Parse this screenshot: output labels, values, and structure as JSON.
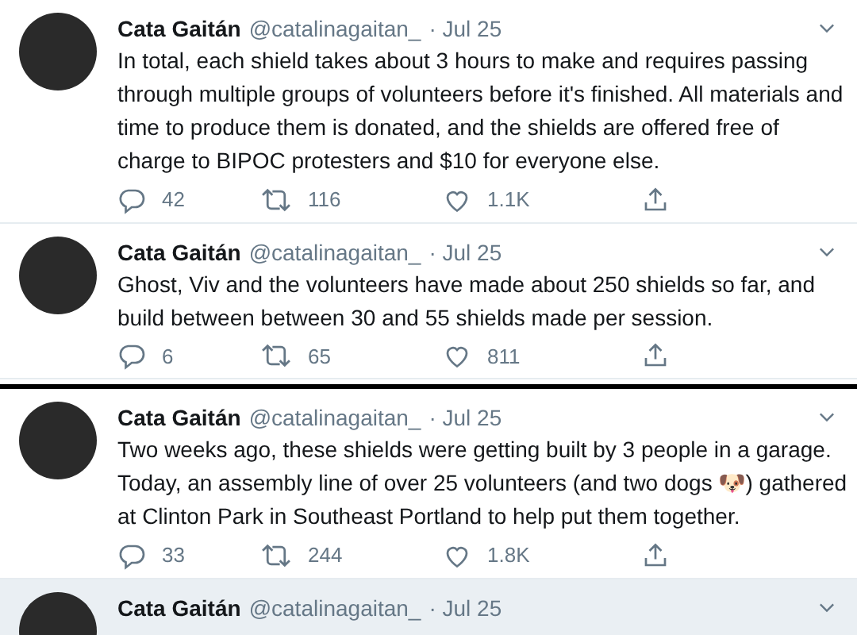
{
  "tweets": [
    {
      "name": "Cata Gaitán",
      "handle": "@catalinagaitan_",
      "date": "· Jul 25",
      "text": [
        "In total, each shield takes about 3 hours to make and requires passing through multiple groups of volunteers before it's finished. All materials and time to produce them is donated, and the shields are offered free of charge to BIPOC protesters and $10 for everyone else."
      ],
      "replies": "42",
      "retweets": "116",
      "likes": "1.1K",
      "highlighted": false,
      "thread_break_after": false
    },
    {
      "name": "Cata Gaitán",
      "handle": "@catalinagaitan_",
      "date": "· Jul 25",
      "text": [
        "Ghost, Viv and the volunteers have made about 250 shields so far, and build between between 30 and 55 shields made per session."
      ],
      "replies": "6",
      "retweets": "65",
      "likes": "811",
      "highlighted": false,
      "thread_break_after": true
    },
    {
      "name": "Cata Gaitán",
      "handle": "@catalinagaitan_",
      "date": "· Jul 25",
      "text": [
        "Two weeks ago, these shields were getting built by 3 people in a garage. Today, an assembly line of over 25 volunteers (and two dogs 🐶) gathered at Clinton Park in Southeast Portland to help put them together."
      ],
      "replies": "33",
      "retweets": "244",
      "likes": "1.8K",
      "highlighted": false,
      "thread_break_after": false
    },
    {
      "name": "Cata Gaitán",
      "handle": "@catalinagaitan_",
      "date": "· Jul 25",
      "highlighted": true,
      "thread_break_after": false
    }
  ]
}
